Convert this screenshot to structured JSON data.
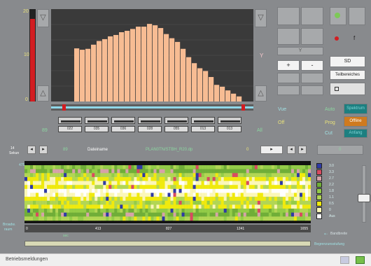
{
  "colors": {
    "panel": "#888a8d",
    "histogram_bg": "#3a3a3a",
    "bar_fill": "#f7bc93",
    "selection_bar": "#8fd7e8",
    "red_level": "#d21d21",
    "legend": [
      "#2f3aa5",
      "#d94a60",
      "#d6a3a8",
      "#70ae38",
      "#93cc48",
      "#b2d655",
      "#f0ea0e",
      "#fbf7b8",
      "#ffffff"
    ]
  },
  "histogram": {
    "y_top": "20",
    "y_mid": "10",
    "y_bottom": "0",
    "left_value": "89",
    "right_value": "All",
    "fwd_icon": "chevron-down-icon",
    "side_icon": "y-axis-icon",
    "bar_values": [
      11.5,
      11.2,
      11.4,
      12.3,
      13.1,
      13.5,
      14.1,
      14.4,
      15.0,
      15.3,
      15.7,
      16.2,
      16.2,
      16.8,
      16.5,
      15.9,
      14.6,
      13.7,
      12.9,
      11.4,
      9.6,
      8.3,
      7.2,
      6.6,
      5.3,
      3.6,
      3.2,
      2.4,
      1.7,
      1.1
    ],
    "time_values": [
      "022",
      "035",
      "036",
      "028",
      "055",
      "013",
      "013"
    ]
  },
  "controls": {
    "plus": "+",
    "minus": "-",
    "y_label": "Y",
    "sd": "SD",
    "teilbereiches": "Teilbereiches",
    "view_label": "Vue",
    "play_label": "Play",
    "off_label": "Off",
    "pen_label": "Prog",
    "cut_label": "Cut",
    "auto_label": "Auto",
    "orange_button": "Offline",
    "teal_top": "Spektrum",
    "teal_bottom": "Anfang"
  },
  "nav": {
    "left_num": "14",
    "left_unit": "Sekun",
    "mid_num": "89",
    "datenname_label": "Dateiname",
    "filename": "PLAN0TN/STBH_R20.dp",
    "page": "0",
    "right_field": "0"
  },
  "heatmap": {
    "ymax": "475",
    "left_bottom_label": "Broadw.",
    "left_bottom_sub": "raum",
    "x_ticks": [
      "0",
      "413",
      "827",
      "1241",
      "1655"
    ],
    "unit_label": "sec",
    "legend_values": [
      "3.0",
      "3.3",
      "2.7",
      "2.2",
      "1.8",
      "1.1",
      "0.5",
      "0",
      "Aus"
    ],
    "bandbreite_label": "Bandbreite",
    "prozess_label": "Begrenzunsstufung"
  },
  "status": {
    "text": "Betriebsmeldungen"
  }
}
